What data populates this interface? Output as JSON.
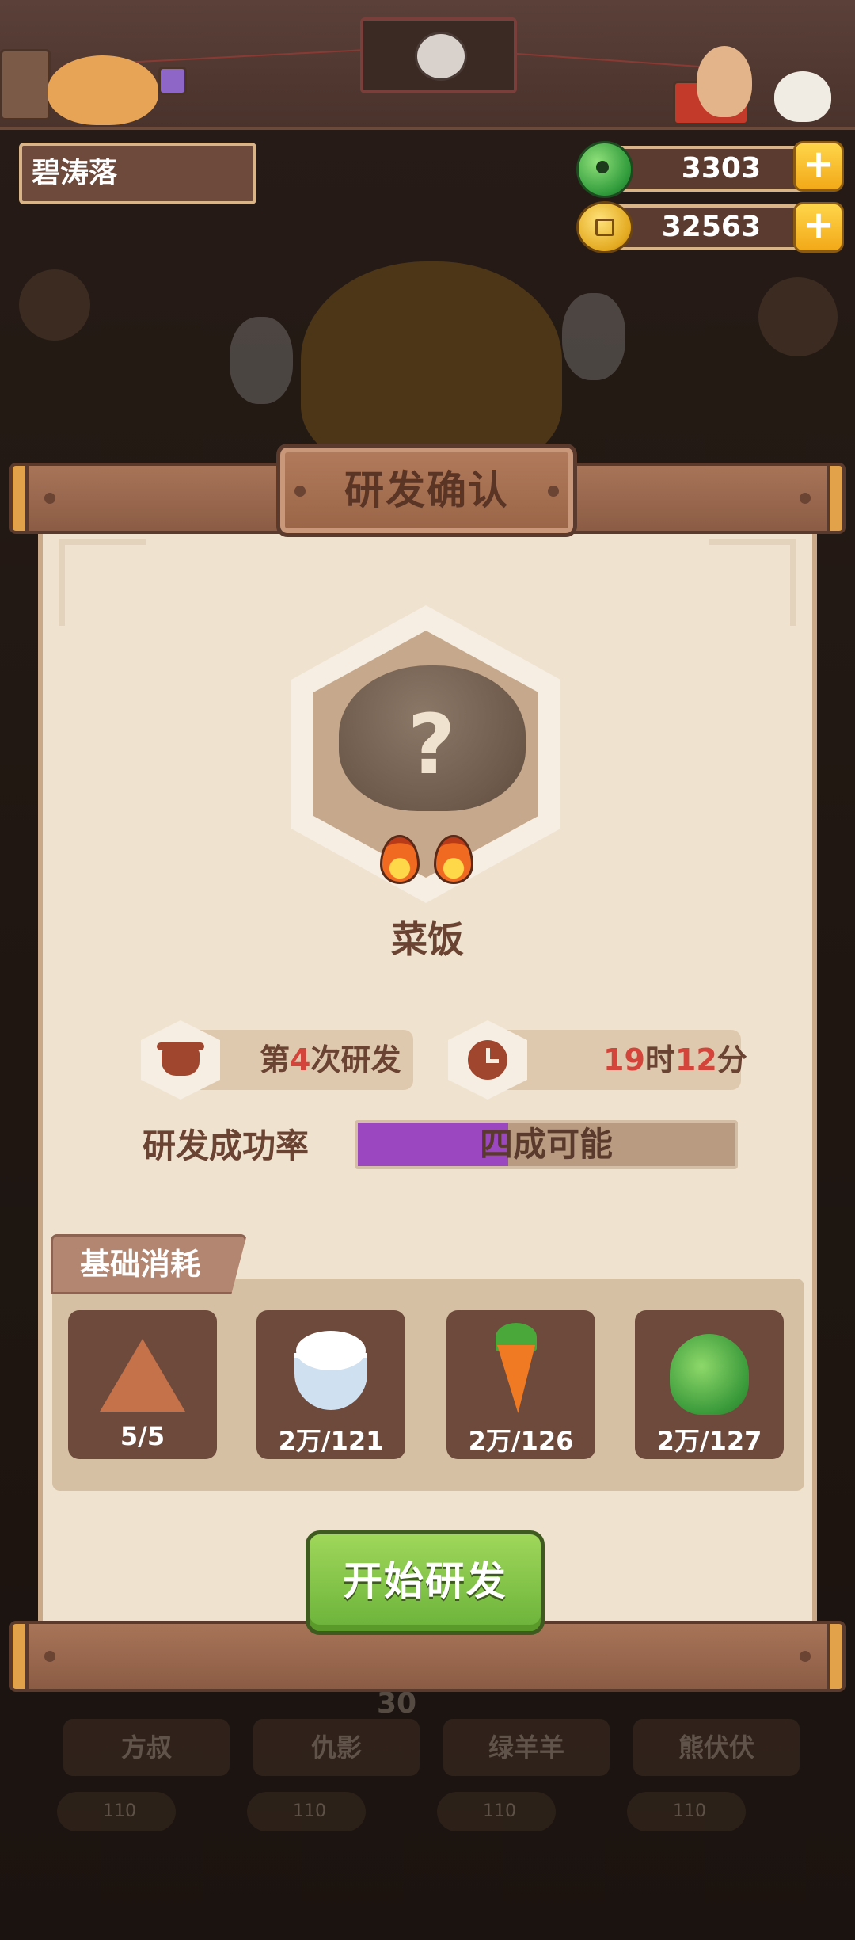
{
  "header": {
    "player_name": "碧涛落",
    "jade": "3303",
    "coins": "32563",
    "plus_label": "+"
  },
  "dialog": {
    "title": "研发确认",
    "dish": {
      "name": "菜饭",
      "unknown_mark": "?",
      "flames": 2
    },
    "attempt": {
      "prefix": "第",
      "number": "4",
      "suffix": "次研发"
    },
    "duration": {
      "hours": "19",
      "hours_unit": "时",
      "minutes": "12",
      "minutes_unit": "分"
    },
    "success_rate": {
      "label": "研发成功率",
      "value_text": "四成可能",
      "fraction": 0.4
    },
    "cost": {
      "section_label": "基础消耗",
      "items": [
        {
          "icon": "zongzi-icon",
          "count": "5/5"
        },
        {
          "icon": "rice-bowl-icon",
          "count": "2万/121"
        },
        {
          "icon": "carrot-icon",
          "count": "2万/126"
        },
        {
          "icon": "bok-choy-icon",
          "count": "2万/127"
        }
      ]
    },
    "start_button": "开始研发"
  },
  "background": {
    "chef_cards": [
      "方叔",
      "仇影",
      "绿羊羊",
      "熊伏伏"
    ],
    "chip_values": [
      "110",
      "110",
      "110",
      "110"
    ],
    "count": "30"
  },
  "colors": {
    "accent_green": "#6bb23a",
    "rate_purple": "#9b48c0",
    "highlight_red": "#d4443a",
    "text_brown": "#6b4332"
  }
}
